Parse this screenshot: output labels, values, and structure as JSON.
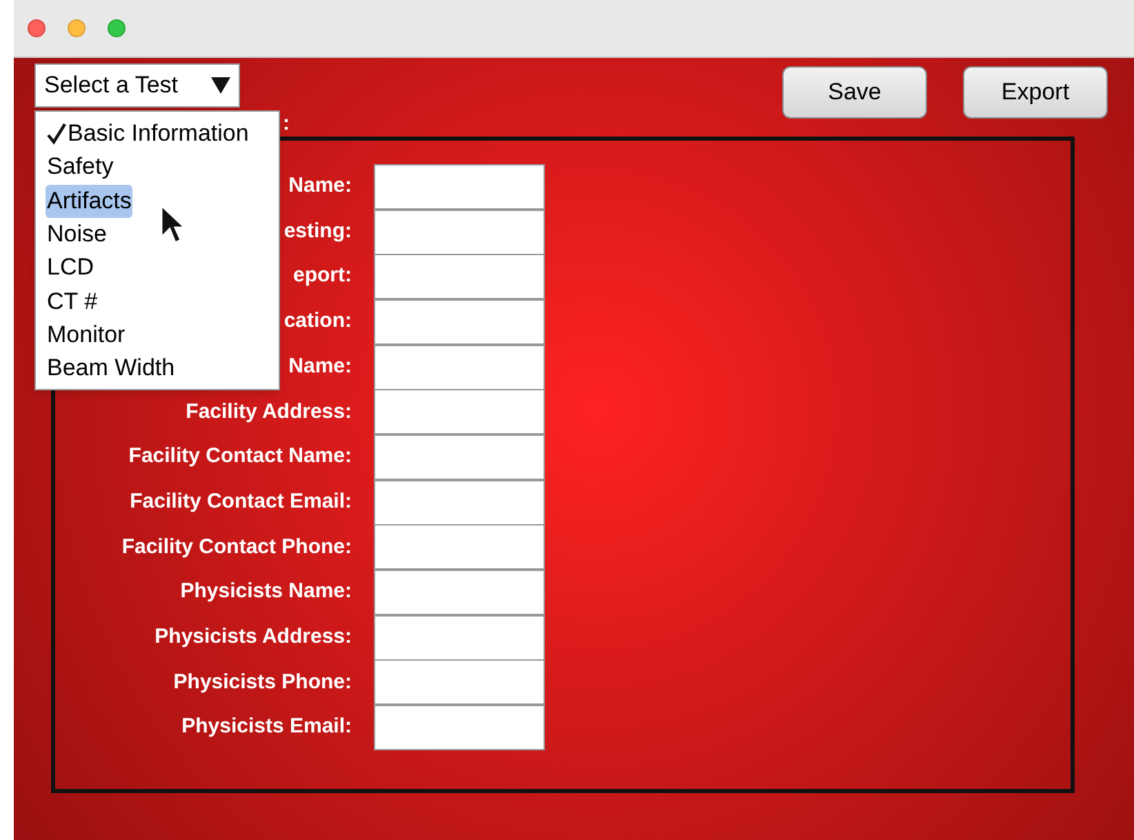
{
  "test_select": {
    "label": "Select a Test",
    "expanded": true,
    "options": [
      {
        "label": "Basic Information",
        "checked": true,
        "highlighted": false
      },
      {
        "label": "Safety",
        "checked": false,
        "highlighted": false
      },
      {
        "label": "Artifacts",
        "checked": false,
        "highlighted": true
      },
      {
        "label": "Noise",
        "checked": false,
        "highlighted": false
      },
      {
        "label": "LCD",
        "checked": false,
        "highlighted": false
      },
      {
        "label": "CT #",
        "checked": false,
        "highlighted": false
      },
      {
        "label": "Monitor",
        "checked": false,
        "highlighted": false
      },
      {
        "label": "Beam Width",
        "checked": false,
        "highlighted": false
      }
    ]
  },
  "buttons": [
    {
      "label": "Save"
    },
    {
      "label": "Export"
    }
  ],
  "section_label": ":",
  "form": {
    "fields": [
      {
        "label": "Name:"
      },
      {
        "label": "esting:"
      },
      {
        "label": "eport:"
      },
      {
        "label": "cation:"
      },
      {
        "label": "Name:"
      },
      {
        "label": "Facility Address:"
      },
      {
        "label": "Facility Contact Name:"
      },
      {
        "label": "Facility Contact Email:"
      },
      {
        "label": "Facility Contact Phone:"
      },
      {
        "label": "Physicists Name:"
      },
      {
        "label": "Physicists Address:"
      },
      {
        "label": "Physicists Phone:"
      },
      {
        "label": "Physicists Email:"
      }
    ]
  }
}
